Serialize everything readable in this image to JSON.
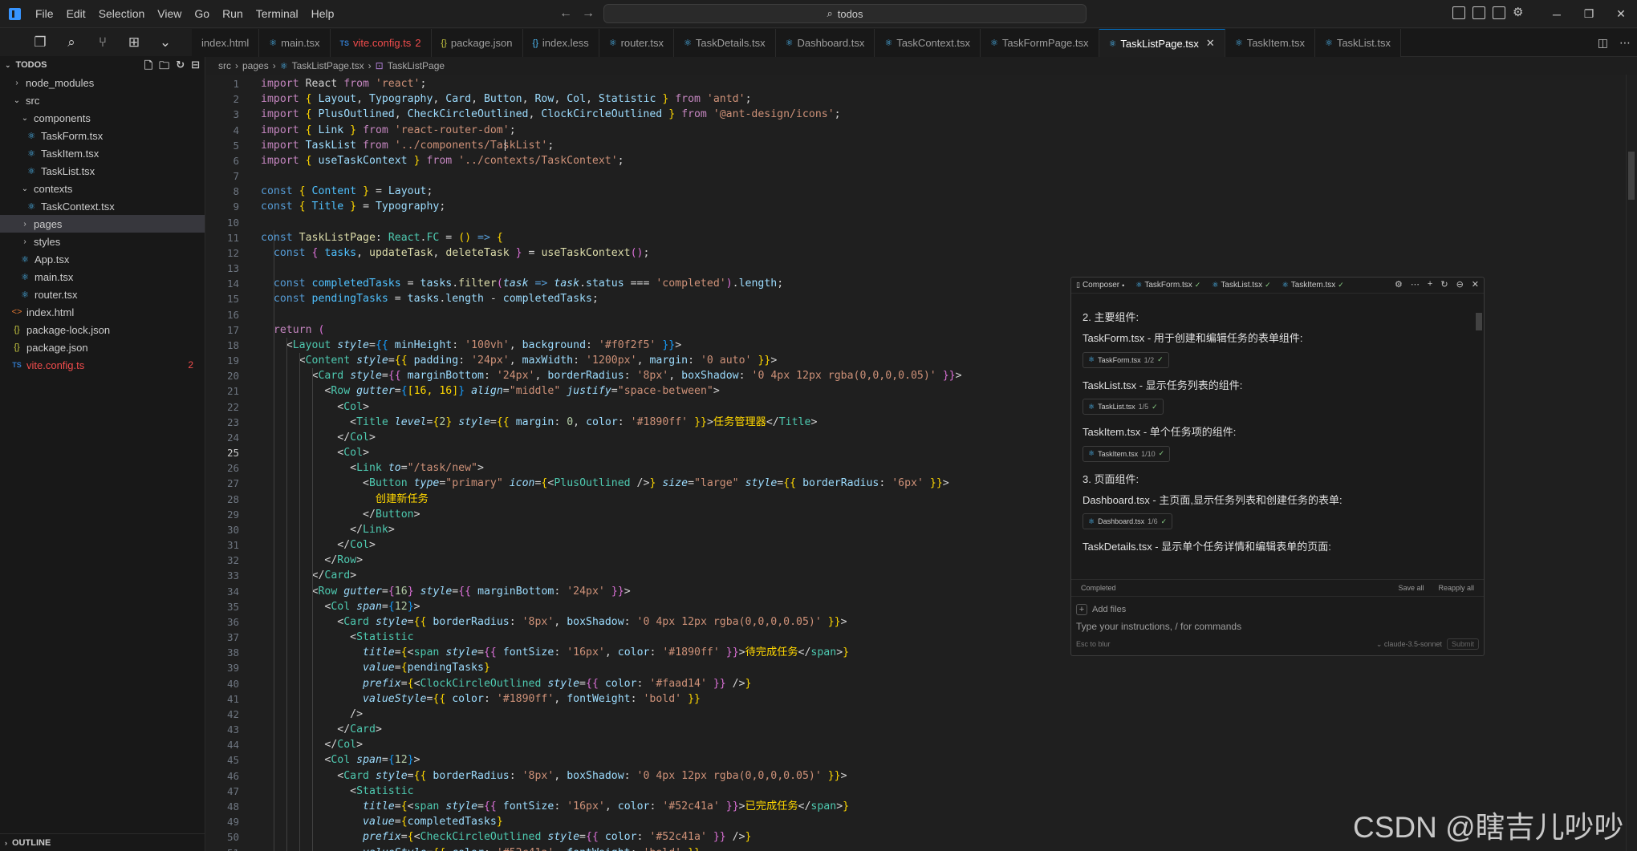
{
  "menu": [
    "File",
    "Edit",
    "Selection",
    "View",
    "Go",
    "Run",
    "Terminal",
    "Help"
  ],
  "search": {
    "text": "todos"
  },
  "explorer": {
    "title": "TODOS",
    "outline": "OUTLINE",
    "tree": [
      {
        "label": "node_modules",
        "type": "folder",
        "open": false,
        "depth": 1
      },
      {
        "label": "src",
        "type": "folder",
        "open": true,
        "depth": 1
      },
      {
        "label": "components",
        "type": "folder",
        "open": true,
        "depth": 2
      },
      {
        "label": "TaskForm.tsx",
        "type": "tsx",
        "depth": 3
      },
      {
        "label": "TaskItem.tsx",
        "type": "tsx",
        "depth": 3
      },
      {
        "label": "TaskList.tsx",
        "type": "tsx",
        "depth": 3
      },
      {
        "label": "contexts",
        "type": "folder",
        "open": true,
        "depth": 2
      },
      {
        "label": "TaskContext.tsx",
        "type": "tsx",
        "depth": 3
      },
      {
        "label": "pages",
        "type": "folder",
        "open": false,
        "depth": 2,
        "selected": true
      },
      {
        "label": "styles",
        "type": "folder",
        "open": false,
        "depth": 2
      },
      {
        "label": "App.tsx",
        "type": "tsx",
        "depth": 2
      },
      {
        "label": "main.tsx",
        "type": "tsx",
        "depth": 2
      },
      {
        "label": "router.tsx",
        "type": "tsx",
        "depth": 2
      },
      {
        "label": "index.html",
        "type": "html",
        "depth": 1
      },
      {
        "label": "package-lock.json",
        "type": "json",
        "depth": 1
      },
      {
        "label": "package.json",
        "type": "json",
        "depth": 1
      },
      {
        "label": "vite.config.ts",
        "type": "ts",
        "depth": 1,
        "error": true,
        "badge": "2"
      }
    ]
  },
  "tabs": [
    {
      "label": "index.html",
      "icon": "html"
    },
    {
      "label": "main.tsx",
      "icon": "tsx"
    },
    {
      "label": "vite.config.ts",
      "icon": "ts",
      "error": true,
      "badge": "2"
    },
    {
      "label": "package.json",
      "icon": "json"
    },
    {
      "label": "index.less",
      "icon": "less"
    },
    {
      "label": "router.tsx",
      "icon": "tsx"
    },
    {
      "label": "TaskDetails.tsx",
      "icon": "tsx"
    },
    {
      "label": "Dashboard.tsx",
      "icon": "tsx"
    },
    {
      "label": "TaskContext.tsx",
      "icon": "tsx"
    },
    {
      "label": "TaskFormPage.tsx",
      "icon": "tsx"
    },
    {
      "label": "TaskListPage.tsx",
      "icon": "tsx",
      "active": true
    },
    {
      "label": "TaskItem.tsx",
      "icon": "tsx"
    },
    {
      "label": "TaskList.tsx",
      "icon": "tsx"
    }
  ],
  "breadcrumb": [
    "src",
    "pages",
    "TaskListPage.tsx",
    "TaskListPage"
  ],
  "editor": {
    "current_line": 25
  },
  "composer": {
    "tabs": [
      {
        "label": "Composer",
        "suffix": "•"
      },
      {
        "label": "TaskForm.tsx",
        "suffix": "✓"
      },
      {
        "label": "TaskList.tsx",
        "suffix": "✓"
      },
      {
        "label": "TaskItem.tsx",
        "suffix": "✓"
      }
    ],
    "blocks": [
      {
        "kind": "text",
        "text": "2. 主要组件:"
      },
      {
        "kind": "text",
        "text": "TaskForm.tsx - 用于创建和编辑任务的表单组件:"
      },
      {
        "kind": "chip",
        "file": "TaskForm.tsx",
        "progress": "1/2"
      },
      {
        "kind": "text",
        "text": "TaskList.tsx - 显示任务列表的组件:"
      },
      {
        "kind": "chip",
        "file": "TaskList.tsx",
        "progress": "1/5"
      },
      {
        "kind": "text",
        "text": "TaskItem.tsx - 单个任务项的组件:"
      },
      {
        "kind": "chip",
        "file": "TaskItem.tsx",
        "progress": "1/10"
      },
      {
        "kind": "text",
        "text": "3. 页面组件:"
      },
      {
        "kind": "text",
        "text": "Dashboard.tsx - 主页面,显示任务列表和创建任务的表单:"
      },
      {
        "kind": "chip",
        "file": "Dashboard.tsx",
        "progress": "1/6"
      },
      {
        "kind": "text",
        "text": "TaskDetails.tsx - 显示单个任务详情和编辑表单的页面:"
      }
    ],
    "status": "Completed",
    "save_all": "Save all",
    "reapply_all": "Reapply all",
    "add_files": "Add files",
    "placeholder": "Type your instructions, / for commands",
    "esc_hint": "Esc to blur",
    "model": "claude-3.5-sonnet",
    "submit": "Submit"
  },
  "watermark": "CSDN @瞎吉儿吵吵"
}
